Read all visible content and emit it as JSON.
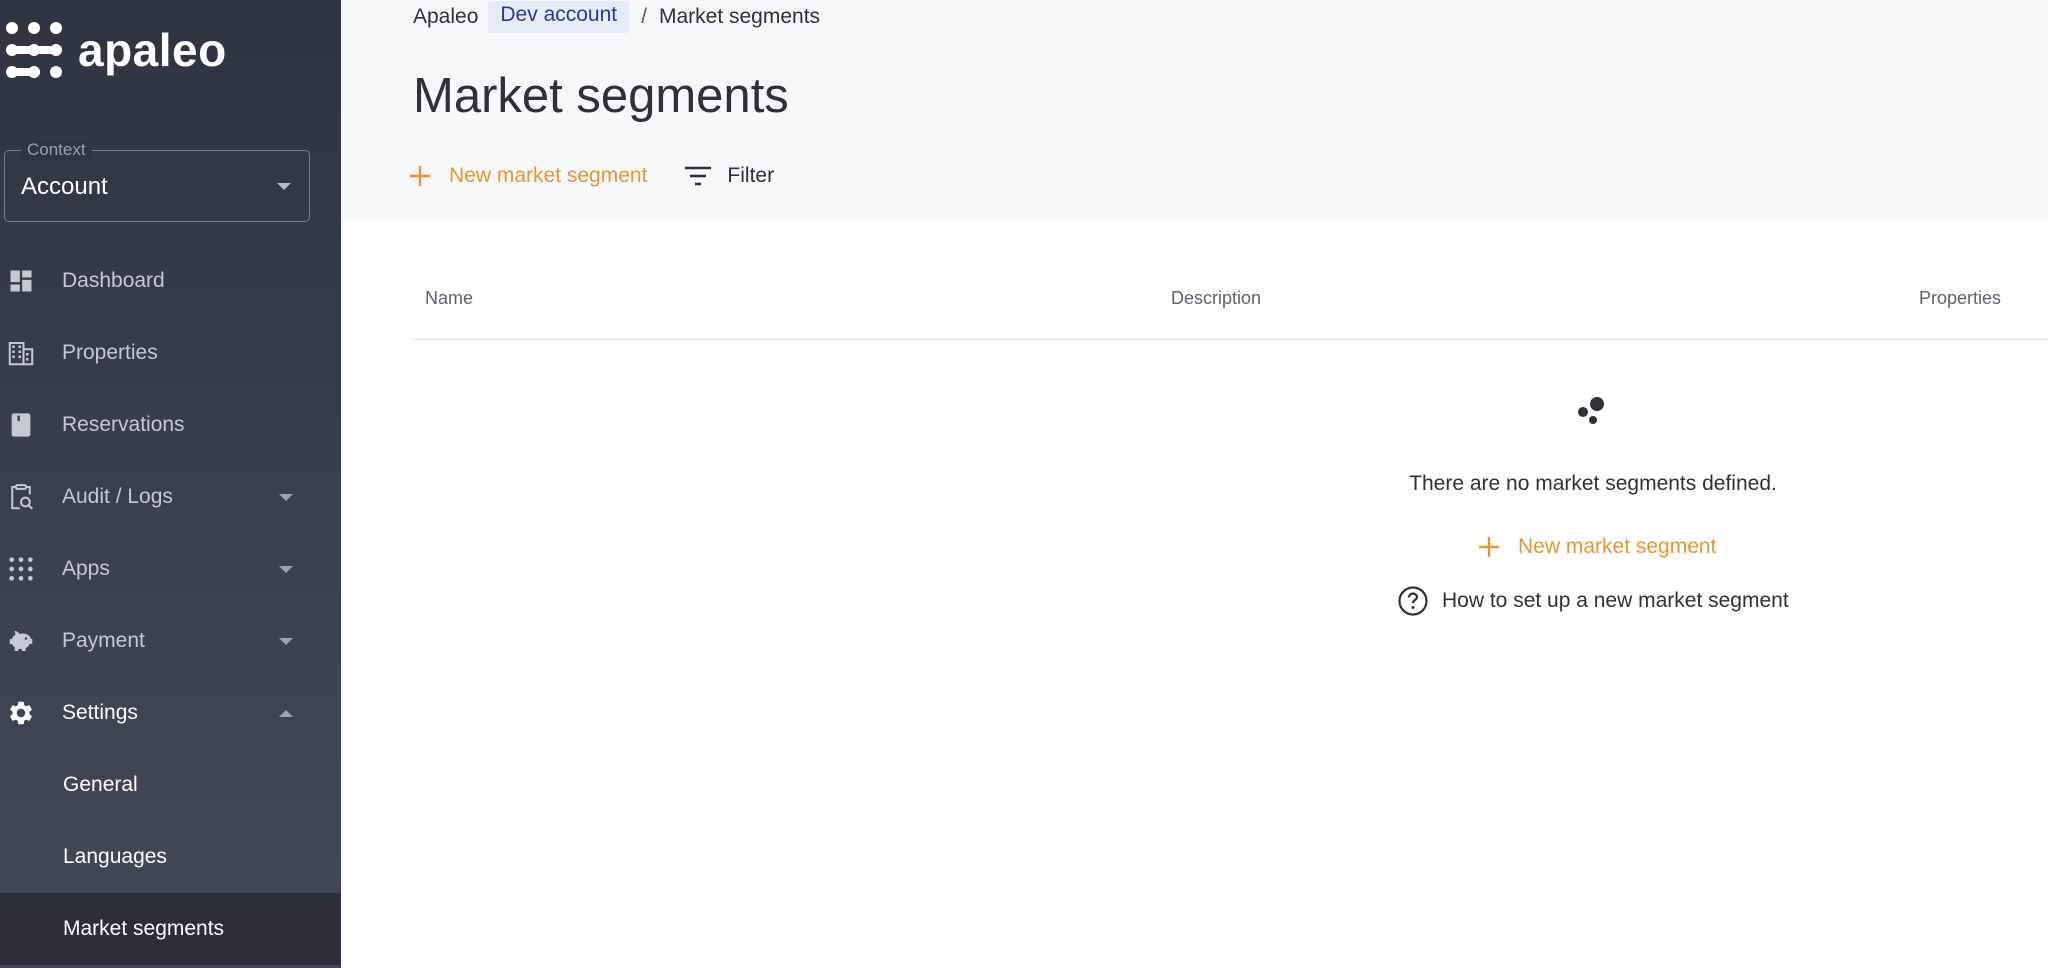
{
  "brand": {
    "name": "apaleo"
  },
  "context": {
    "legend": "Context",
    "value": "Account"
  },
  "nav": {
    "items": [
      {
        "label": "Dashboard",
        "icon": "dashboard-icon"
      },
      {
        "label": "Properties",
        "icon": "properties-icon"
      },
      {
        "label": "Reservations",
        "icon": "reservations-icon"
      },
      {
        "label": "Audit / Logs",
        "icon": "audit-logs-icon",
        "expandable": true
      },
      {
        "label": "Apps",
        "icon": "apps-icon",
        "expandable": true
      },
      {
        "label": "Payment",
        "icon": "payment-icon",
        "expandable": true
      },
      {
        "label": "Settings",
        "icon": "settings-icon",
        "expanded": true
      }
    ],
    "settings_sub": [
      "General",
      "Languages",
      "Market segments"
    ],
    "selected_sub": "Market segments"
  },
  "breadcrumb": {
    "root": "Apaleo",
    "link": "Dev account",
    "separator": "/",
    "current": "Market segments"
  },
  "page": {
    "title": "Market segments"
  },
  "toolbar": {
    "new_label": "New market segment",
    "filter_label": "Filter"
  },
  "table": {
    "columns": [
      "Name",
      "Description",
      "Properties"
    ],
    "rows": []
  },
  "empty_state": {
    "message": "There are no market segments defined.",
    "new_label": "New market segment",
    "help_label": "How to set up a new market segment"
  },
  "colors": {
    "accent": "#e8952f",
    "sidebar": "#3a404d",
    "link_bg": "#e6ebf7",
    "link_text": "#2b3a91"
  }
}
